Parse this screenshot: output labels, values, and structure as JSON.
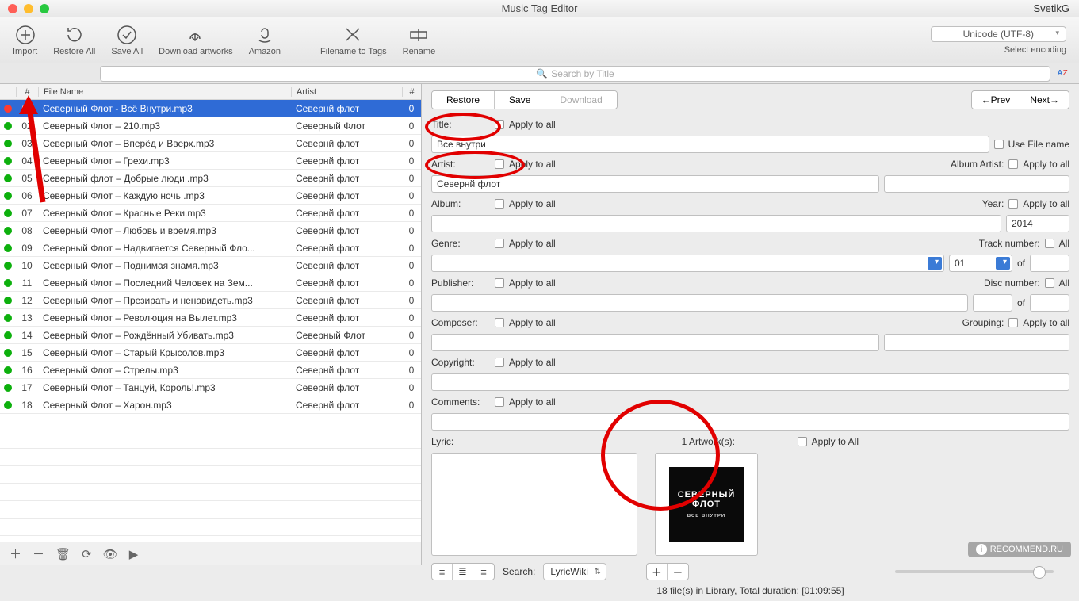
{
  "window": {
    "title": "Music Tag Editor",
    "user": "SvetikG"
  },
  "toolbar": {
    "import": "Import",
    "restore_all": "Restore All",
    "save_all": "Save All",
    "download_artworks": "Download artworks",
    "amazon": "Amazon",
    "filename_to_tags": "Filename to Tags",
    "rename": "Rename",
    "encoding": "Unicode (UTF-8)",
    "select_encoding": "Select encoding"
  },
  "search": {
    "placeholder": "Search by Title",
    "sort_label": "A↓Z"
  },
  "list": {
    "headers": {
      "num": "#",
      "file": "File Name",
      "artist": "Artist",
      "trk": "#"
    },
    "rows": [
      {
        "status": "red",
        "num": "01",
        "file": "Северный Флот - Всё Внутри.mp3",
        "artist": "Севернй флот",
        "trk": "0",
        "selected": true
      },
      {
        "status": "green",
        "num": "02",
        "file": "Северный Флот – 210.mp3",
        "artist": "Северный Флот",
        "trk": "0"
      },
      {
        "status": "green",
        "num": "03",
        "file": "Северный Флот – Вперёд и Вверх.mp3",
        "artist": "Севернй флот",
        "trk": "0"
      },
      {
        "status": "green",
        "num": "04",
        "file": "Северный Флот – Грехи.mp3",
        "artist": "Севернй флот",
        "trk": "0"
      },
      {
        "status": "green",
        "num": "05",
        "file": "Северный флот – Добрые люди .mp3",
        "artist": "Севернй флот",
        "trk": "0"
      },
      {
        "status": "green",
        "num": "06",
        "file": "Северный Флот – Каждую ночь .mp3",
        "artist": "Севернй флот",
        "trk": "0"
      },
      {
        "status": "green",
        "num": "07",
        "file": "Северный Флот – Красные Реки.mp3",
        "artist": "Севернй флот",
        "trk": "0"
      },
      {
        "status": "green",
        "num": "08",
        "file": "Северный Флот – Любовь и время.mp3",
        "artist": "Севернй флот",
        "trk": "0"
      },
      {
        "status": "green",
        "num": "09",
        "file": "Северный Флот – Надвигается Северный Фло...",
        "artist": "Севернй флот",
        "trk": "0"
      },
      {
        "status": "green",
        "num": "10",
        "file": "Северный Флот – Поднимая знамя.mp3",
        "artist": "Севернй флот",
        "trk": "0"
      },
      {
        "status": "green",
        "num": "11",
        "file": "Северный Флот – Последний Человек на Зем...",
        "artist": "Севернй флот",
        "trk": "0"
      },
      {
        "status": "green",
        "num": "12",
        "file": "Северный Флот – Презирать и ненавидеть.mp3",
        "artist": "Севернй флот",
        "trk": "0"
      },
      {
        "status": "green",
        "num": "13",
        "file": "Северный Флот – Революция на Вылет.mp3",
        "artist": "Севернй флот",
        "trk": "0"
      },
      {
        "status": "green",
        "num": "14",
        "file": "Северный Флот – Рождённый Убивать.mp3",
        "artist": "Северный Флот",
        "trk": "0"
      },
      {
        "status": "green",
        "num": "15",
        "file": "Северный Флот – Старый Крысолов.mp3",
        "artist": "Севернй флот",
        "trk": "0"
      },
      {
        "status": "green",
        "num": "16",
        "file": "Северный Флот – Стрелы.mp3",
        "artist": "Севернй флот",
        "trk": "0"
      },
      {
        "status": "green",
        "num": "17",
        "file": "Северный Флот – Танцуй, Король!.mp3",
        "artist": "Севернй флот",
        "trk": "0"
      },
      {
        "status": "green",
        "num": "18",
        "file": "Северный Флот – Харон.mp3",
        "artist": "Севернй флот",
        "trk": "0"
      }
    ]
  },
  "buttons": {
    "restore": "Restore",
    "save": "Save",
    "download": "Download",
    "prev": "←Prev",
    "next": "Next→"
  },
  "form": {
    "apply_all": "Apply to all",
    "apply_all_cap": "Apply to All",
    "all": "All",
    "title_lbl": "Title:",
    "title_val": "Все внутри",
    "use_file_name": "Use File name",
    "artist_lbl": "Artist:",
    "artist_val": "Севернй флот",
    "album_artist_lbl": "Album Artist:",
    "album_artist_val": "",
    "album_lbl": "Album:",
    "album_val": "",
    "year_lbl": "Year:",
    "year_val": "2014",
    "genre_lbl": "Genre:",
    "genre_val": "",
    "track_lbl": "Track number:",
    "track_val": "01",
    "of": "of",
    "track_total": "",
    "publisher_lbl": "Publisher:",
    "publisher_val": "",
    "disc_lbl": "Disc number:",
    "disc_val": "",
    "disc_total": "",
    "composer_lbl": "Composer:",
    "composer_val": "",
    "grouping_lbl": "Grouping:",
    "grouping_val": "",
    "copyright_lbl": "Copyright:",
    "copyright_val": "",
    "comments_lbl": "Comments:",
    "comments_val": "",
    "lyric_lbl": "Lyric:",
    "artwork_lbl": "1 Artwork(s):",
    "search_lbl": "Search:",
    "lyric_source": "LyricWiki"
  },
  "artwork": {
    "line1": "СЕВЕРНЫЙ",
    "line2": "ФЛОТ",
    "line3": "ВСЕ ВНУТРИ"
  },
  "status": "18 file(s) in Library, Total duration: [01:09:55]",
  "watermark": "RECOMMEND.RU"
}
